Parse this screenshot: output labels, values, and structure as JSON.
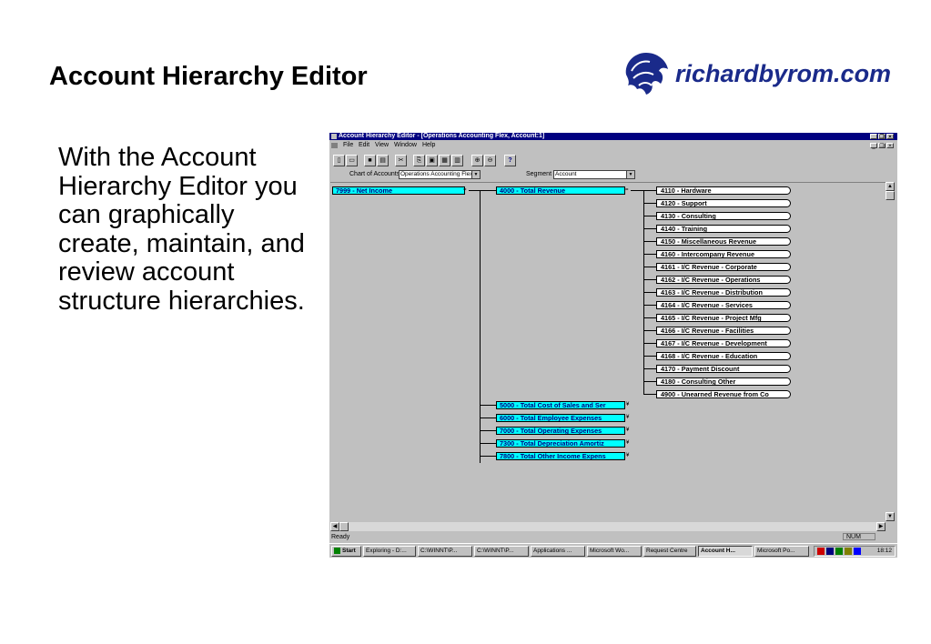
{
  "slide": {
    "title": "Account Hierarchy Editor",
    "logo_text": "richardbyrom.com",
    "body": "With the Account Hierarchy Editor you can graphically create, maintain, and review account structure hierarchies."
  },
  "window": {
    "title": "Account Hierarchy Editor - [Operations Accounting Flex, Account:1]",
    "menu": [
      "File",
      "Edit",
      "View",
      "Window",
      "Help"
    ],
    "chart_label": "Chart of Accounts",
    "chart_value": "Operations Accounting Flex",
    "segment_label": "Segment",
    "segment_value": "Account",
    "root": "7999 - Net Income",
    "level1": [
      "4000 - Total  Revenue",
      "5000 - Total Cost of Sales and Ser",
      "6000 - Total Employee Expenses",
      "7000 - Total Operating Expenses",
      "7300 - Total Depreciation  Amortiz",
      "7800 - Total Other Income  Expens"
    ],
    "revenue_children": [
      "4110 - Hardware",
      "4120 - Support",
      "4130 - Consulting",
      "4140 - Training",
      "4150 - Miscellaneous Revenue",
      "4160 - Intercompany Revenue",
      "4161 - I/C Revenue - Corporate",
      "4162 - I/C Revenue - Operations",
      "4163 - I/C Revenue - Distribution",
      "4164 - I/C Revenue - Services",
      "4165 - I/C Revenue - Project Mfg",
      "4166 - I/C Revenue - Facilities",
      "4167 - I/C Revenue - Development",
      "4168 - I/C Revenue - Education",
      "4170 - Payment Discount",
      "4180 - Consulting Other",
      "4900 - Unearned Revenue from Co"
    ],
    "status_text": "Ready",
    "status_num": "NUM"
  },
  "taskbar": {
    "start": "Start",
    "tasks": [
      "Exploring - D:...",
      "C:\\WINNT\\P...",
      "C:\\WINNT\\P...",
      "Applications ...",
      "Microsoft Wo...",
      "Request Centre",
      "Account H...",
      "Microsoft Po..."
    ],
    "clock": "18:12"
  },
  "colors": {
    "titlebar": "#000080",
    "node_fill": "#00ffff",
    "window_bg": "#c0c0c0",
    "logo_blue": "#1a2a8a"
  }
}
